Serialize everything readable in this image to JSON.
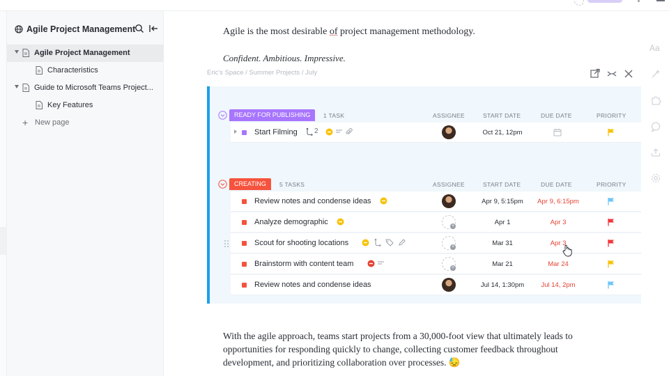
{
  "sidebar": {
    "title": "Agile Project Management",
    "items": [
      {
        "label": "Agile Project Management"
      },
      {
        "label": "Characteristics"
      },
      {
        "label": "Guide to Microsoft Teams Project..."
      },
      {
        "label": "Key Features"
      },
      {
        "label": "New page"
      }
    ]
  },
  "doc": {
    "p1_a": "Agile is the most desirable ",
    "p1_b": "of",
    "p1_c": " project management methodology.",
    "p2": "Confident. Ambitious. Impressive.",
    "embed_breadcrumb": "Eric's Space / Summer Projects / July",
    "p3": "With the agile approach, teams start projects from a 30,000-foot view that ultimately leads to opportunities for responding quickly to change, collecting customer feedback throughout development, and prioritizing collaboration over processes. 😓"
  },
  "columns": {
    "assignee": "ASSIGNEE",
    "start": "START DATE",
    "due": "DUE DATE",
    "priority": "PRIORITY"
  },
  "groups": [
    {
      "status": "READY FOR PUBLISHING",
      "count": "1 TASK",
      "color": "#a875ff",
      "tasks": [
        {
          "name": "Start Filming",
          "subtasks": "2",
          "start": "Oct 21, 12pm",
          "due": "",
          "flag": "#f8c20b"
        }
      ]
    },
    {
      "status": "CREATING",
      "count": "5 TASKS",
      "color": "#f5533d",
      "tasks": [
        {
          "name": "Review notes and condense ideas",
          "start": "Apr 9, 5:15pm",
          "due": "Apr 9, 6:15pm",
          "flag": "#6fc6f7"
        },
        {
          "name": "Analyze demographic",
          "start": "Apr 1",
          "due": "Apr 3",
          "flag": "#f0373c"
        },
        {
          "name": "Scout for shooting locations",
          "start": "Mar 31",
          "due": "Apr 3",
          "flag": "#f0373c"
        },
        {
          "name": "Brainstorm with content team",
          "start": "Mar 21",
          "due": "Mar 24",
          "flag": "#f8c20b"
        },
        {
          "name": "Review notes and condense ideas",
          "start": "Jul 14, 1:30pm",
          "due": "Jul 14, 2pm",
          "flag": "#6fc6f7"
        }
      ]
    }
  ],
  "rail": {
    "text_icon": "Aa"
  },
  "colors": {
    "accent_blue": "#1ba1e8",
    "ready": "#a875ff",
    "creating": "#f5533d",
    "due_red": "#e44332"
  }
}
